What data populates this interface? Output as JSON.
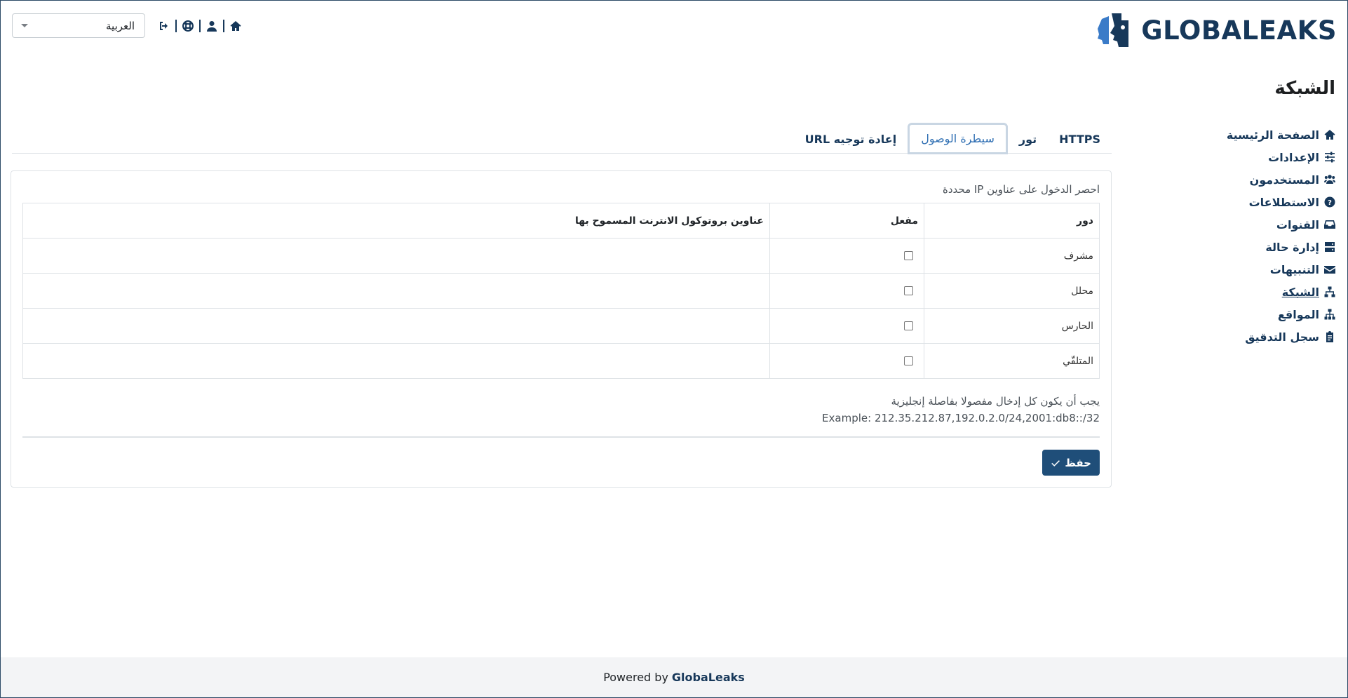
{
  "header": {
    "brand": "GLOBALEAKS",
    "language": "العربية",
    "icons": [
      "home-icon",
      "user-icon",
      "support-icon",
      "logout-icon"
    ]
  },
  "page": {
    "title": "الشبكة"
  },
  "sidebar": {
    "items": [
      {
        "label": "الصفحة الرئيسية",
        "icon": "home-icon"
      },
      {
        "label": "الإعدادات",
        "icon": "sliders-icon"
      },
      {
        "label": "المستخدمون",
        "icon": "users-icon"
      },
      {
        "label": "الاستطلاعات",
        "icon": "question-icon"
      },
      {
        "label": "القنوات",
        "icon": "inbox-icon"
      },
      {
        "label": "إدارة حالة",
        "icon": "server-icon"
      },
      {
        "label": "التنبيهات",
        "icon": "envelope-icon"
      },
      {
        "label": "الشبكة",
        "icon": "network-icon",
        "active": true
      },
      {
        "label": "المواقع",
        "icon": "sitemap-icon"
      },
      {
        "label": "سجل التدقيق",
        "icon": "clipboard-icon"
      }
    ]
  },
  "tabs": [
    {
      "label": "HTTPS"
    },
    {
      "label": "تور"
    },
    {
      "label": "سيطرة الوصول",
      "active": true
    },
    {
      "label": "إعادة توجيه URL"
    }
  ],
  "access_control": {
    "label": "احصر الدخول على عناوين IP محددة",
    "columns": {
      "role": "دور",
      "enabled": "مفعل",
      "allowed_ips": "عناوين بروتوكول الانترنت المسموح بها"
    },
    "rows": [
      {
        "role": "مشرف",
        "enabled": false,
        "allowed_ips": ""
      },
      {
        "role": "محلل",
        "enabled": false,
        "allowed_ips": ""
      },
      {
        "role": "الحارس",
        "enabled": false,
        "allowed_ips": ""
      },
      {
        "role": "المتلقّي",
        "enabled": false,
        "allowed_ips": ""
      }
    ],
    "hint": "يجب أن يكون كل إدخال مفصولا بفاصلة إنجليزية",
    "example": "Example: 212.35.212.87,192.0.2.0/24,2001:db8::/32",
    "save_label": "حفظ"
  },
  "footer": {
    "prefix": "Powered by",
    "brand": "GlobaLeaks"
  }
}
